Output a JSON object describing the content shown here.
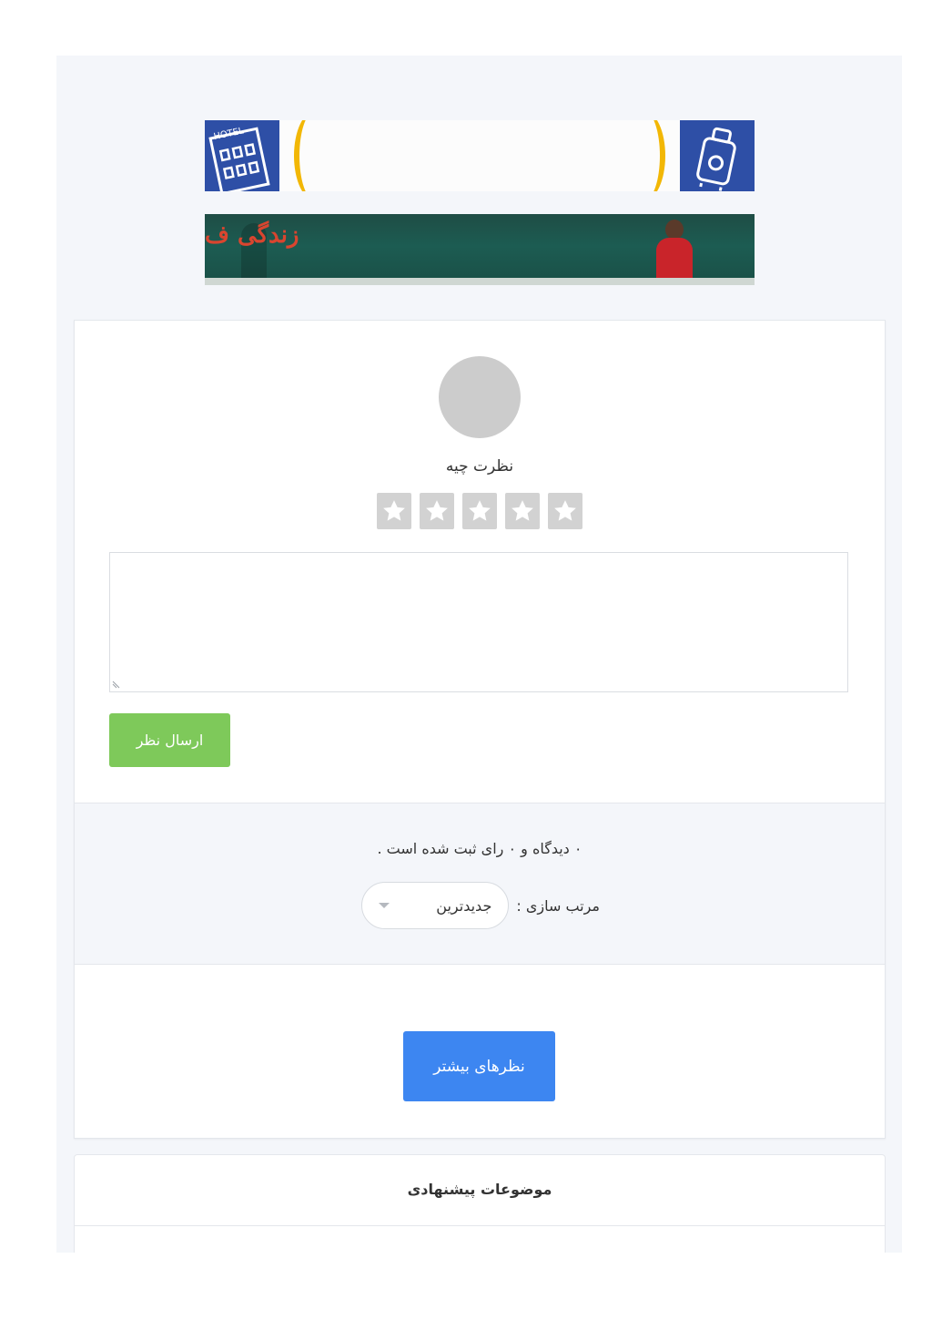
{
  "banners": {
    "hotel": {
      "name": "hotel-travel-banner",
      "hotel_sign": "HOTEL"
    },
    "school": {
      "name": "school-banner",
      "text": "زندگی ف"
    }
  },
  "comment_form": {
    "title": "نظرت چیه",
    "stars_count": 5,
    "textarea_value": "",
    "submit_label": "ارسال نظر"
  },
  "comments_info": {
    "count_text": "۰ دیدگاه و ۰ رای ثبت شده است .",
    "sort_label": "مرتب سازی :",
    "sort_value": "جدیدترین"
  },
  "more_comments_label": "نظرهای بیشتر",
  "suggested": {
    "title": "موضوعات پیشنهادی"
  },
  "colors": {
    "submit": "#7ec95a",
    "more": "#3d86f1",
    "star_bg": "#d2d2d2",
    "page_bg": "#f4f6fa"
  }
}
